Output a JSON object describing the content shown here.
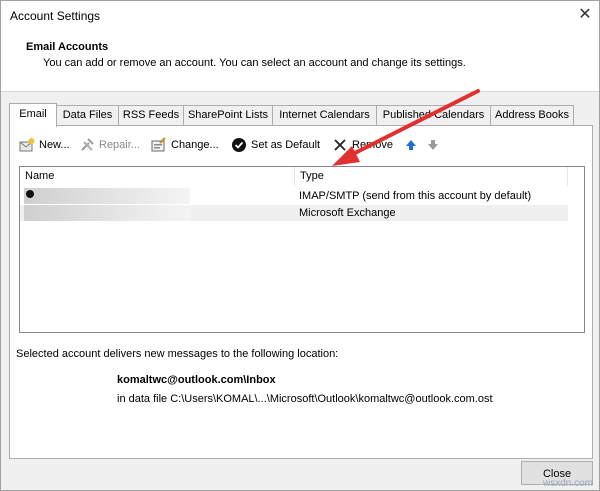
{
  "window": {
    "title": "Account Settings",
    "close_glyph": "✕"
  },
  "header": {
    "title": "Email Accounts",
    "description": "You can add or remove an account. You can select an account and change its settings."
  },
  "tabs": [
    {
      "label": "Email",
      "active": true
    },
    {
      "label": "Data Files"
    },
    {
      "label": "RSS Feeds"
    },
    {
      "label": "SharePoint Lists"
    },
    {
      "label": "Internet Calendars"
    },
    {
      "label": "Published Calendars"
    },
    {
      "label": "Address Books"
    }
  ],
  "toolbar": {
    "new_label": "New...",
    "repair_label": "Repair...",
    "change_label": "Change...",
    "set_default_label": "Set as Default",
    "remove_label": "Remove"
  },
  "list": {
    "col_name": "Name",
    "col_type": "Type",
    "rows": [
      {
        "type": "IMAP/SMTP (send from this account by default)"
      },
      {
        "type": "Microsoft Exchange"
      }
    ]
  },
  "delivery": {
    "info": "Selected account delivers new messages to the following location:",
    "folder": "komaltwc@outlook.com\\Inbox",
    "datafile": "in data file C:\\Users\\KOMAL\\...\\Microsoft\\Outlook\\komaltwc@outlook.com.ost"
  },
  "close_button": "Close",
  "watermark": "wsxdn.com",
  "colors": {
    "annotation_arrow": "#e03030",
    "accent_blue": "#1f6fd1"
  }
}
